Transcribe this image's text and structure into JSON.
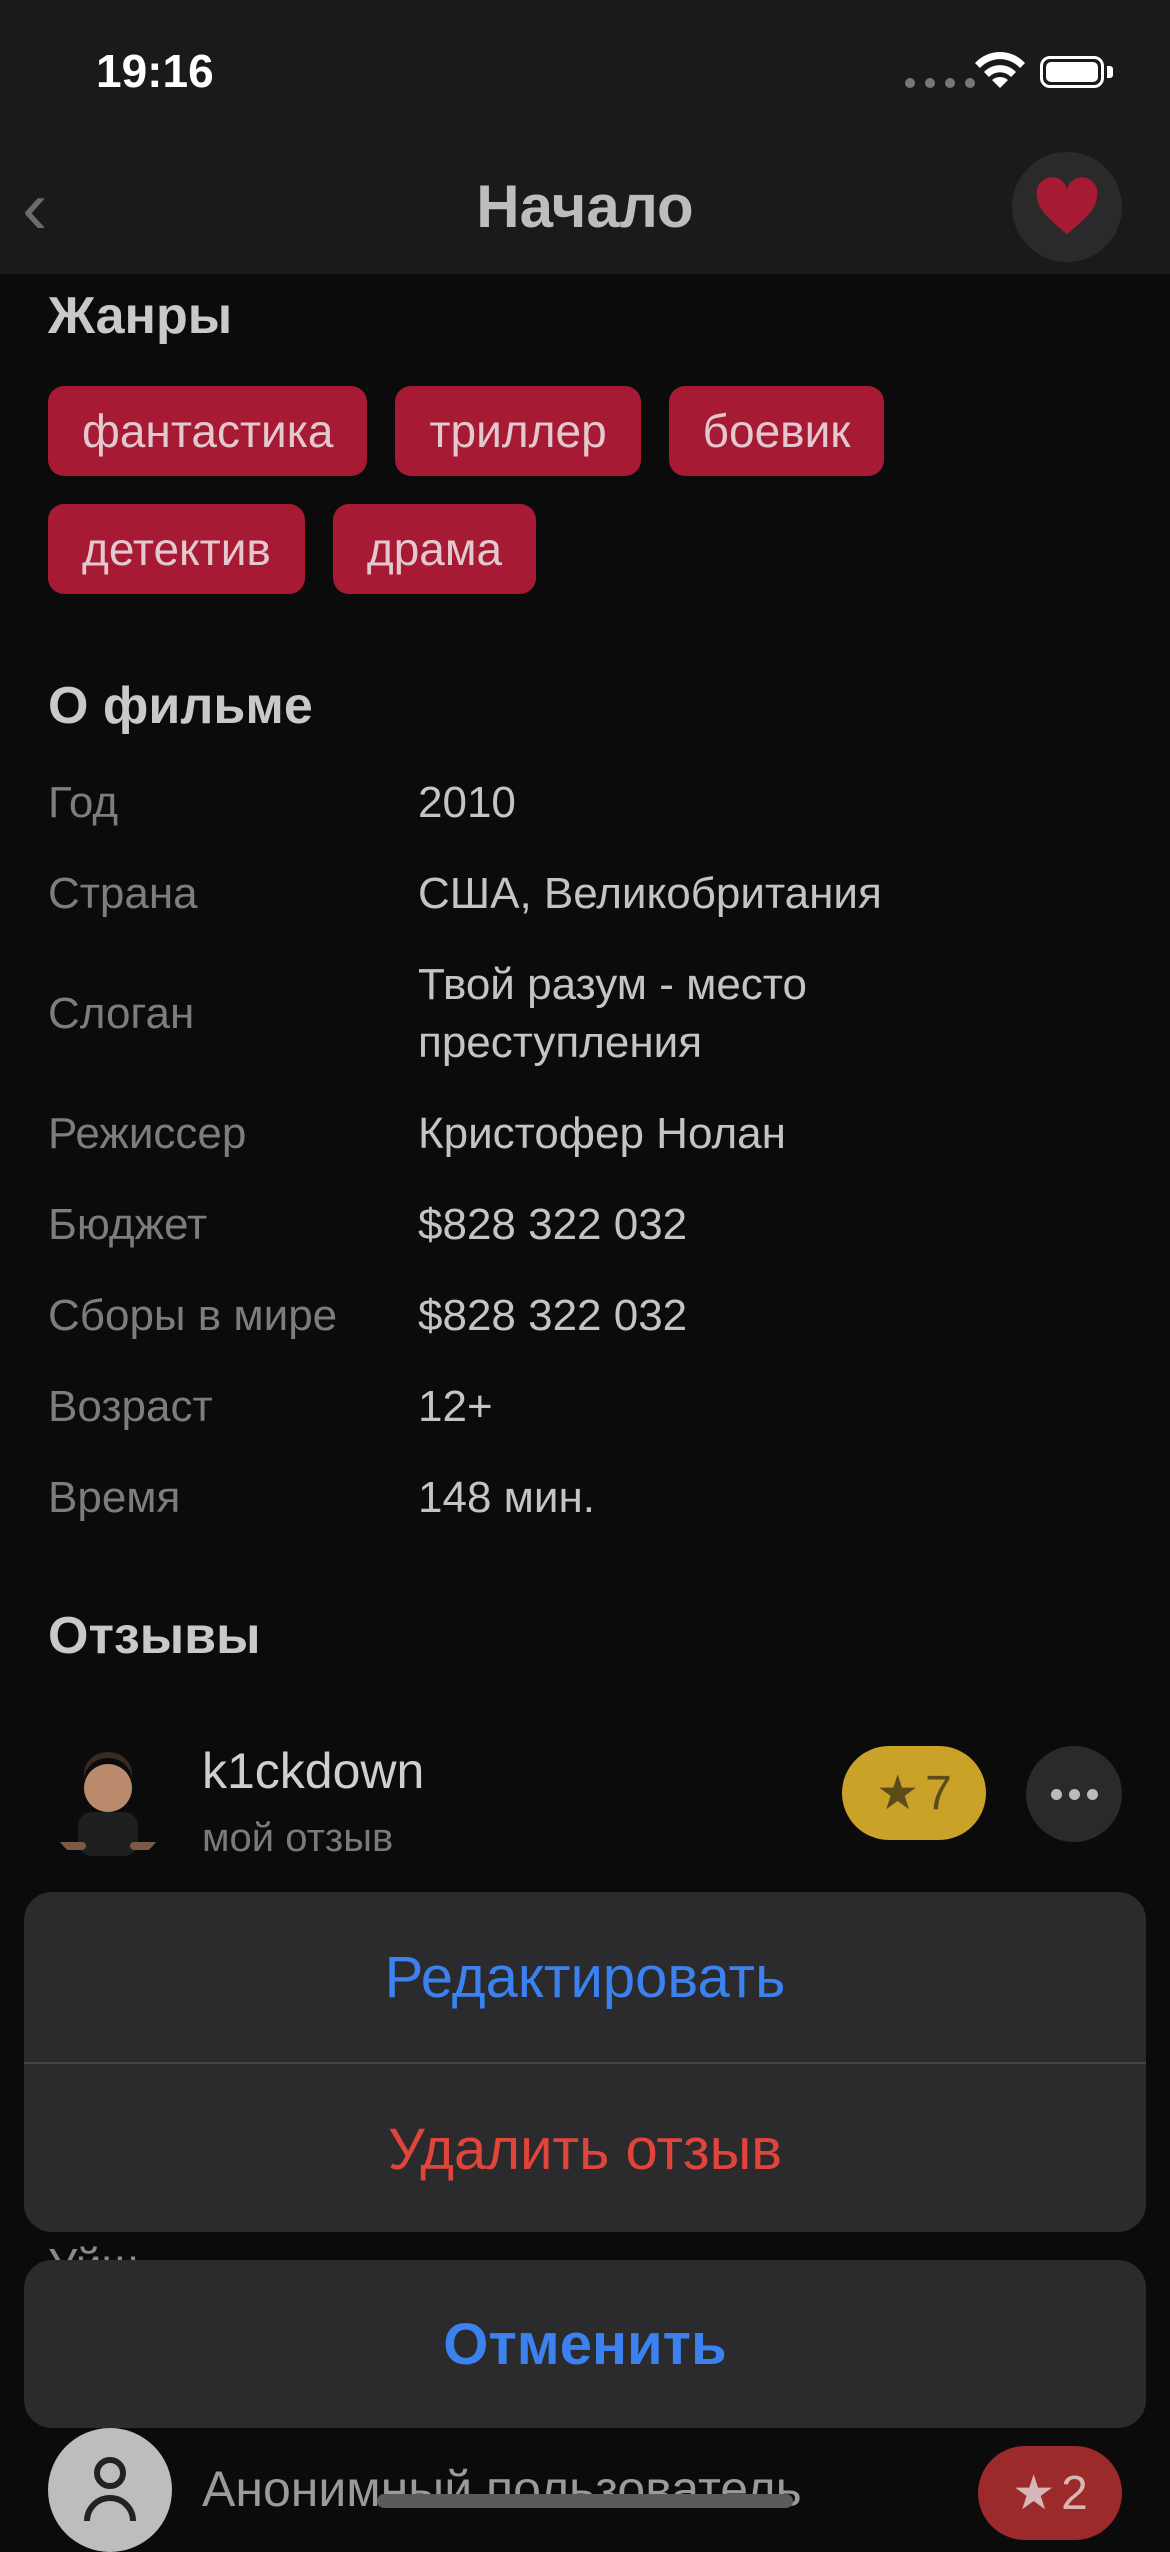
{
  "status_bar": {
    "time": "19:16"
  },
  "nav": {
    "title": "Начало"
  },
  "genres": {
    "title": "Жанры",
    "items": [
      "фантастика",
      "триллер",
      "боевик",
      "детектив",
      "драма"
    ]
  },
  "about": {
    "title": "О фильме",
    "rows": [
      {
        "label": "Год",
        "value": "2010"
      },
      {
        "label": "Страна",
        "value": "США, Великобритания"
      },
      {
        "label": "Слоган",
        "value": "Твой разум - место преступления"
      },
      {
        "label": "Режиссер",
        "value": "Кристофер Нолан"
      },
      {
        "label": "Бюджет",
        "value": "$828 322 032"
      },
      {
        "label": "Сборы в мире",
        "value": "$828 322 032"
      },
      {
        "label": "Возраст",
        "value": "12+"
      },
      {
        "label": "Время",
        "value": "148 мин."
      }
    ]
  },
  "reviews": {
    "title": "Отзывы",
    "items": [
      {
        "user": "k1ckdown",
        "subtitle": "мой отзыв",
        "rating": "7"
      },
      {
        "user": "Анонимный пользователь",
        "subtitle": "",
        "rating": "2"
      }
    ],
    "partial_text": "Уйш"
  },
  "action_sheet": {
    "edit": "Редактировать",
    "delete": "Удалить отзыв",
    "cancel": "Отменить"
  },
  "colors": {
    "genre_chip": "#a61a33",
    "rating_high": "#c9a227",
    "rating_low": "#9c2a2a",
    "action_blue": "#3b82f0",
    "destructive_red": "#e0443b"
  }
}
